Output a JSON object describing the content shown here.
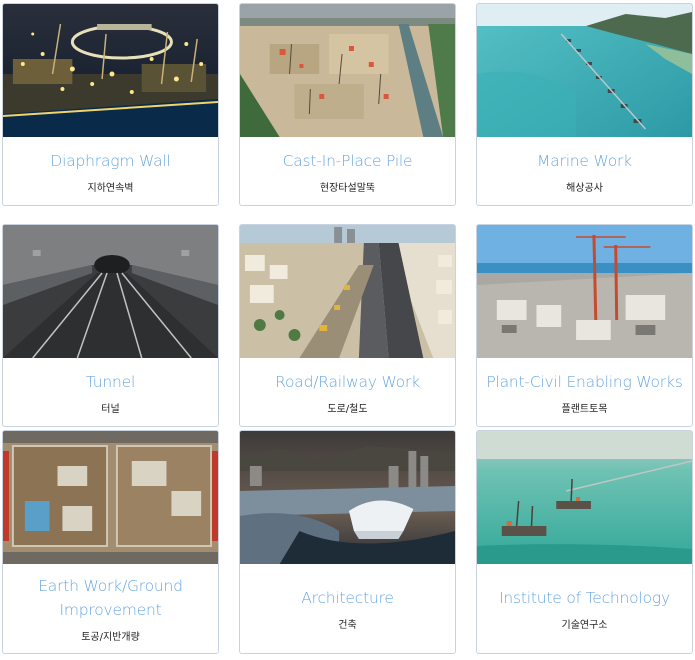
{
  "colors": {
    "title": "#6aa7e0",
    "subtitle": "#222222",
    "border": "#c9d3df"
  },
  "cards": [
    {
      "title": "Diaphragm Wall",
      "subtitle": "지하연속벽",
      "image": "diaphragm-wall-photo"
    },
    {
      "title": "Cast-In-Place Pile",
      "subtitle": "현장타설말뚝",
      "image": "cast-in-place-pile-photo"
    },
    {
      "title": "Marine Work",
      "subtitle": "해상공사",
      "image": "marine-work-photo"
    },
    {
      "title": "Tunnel",
      "subtitle": "터널",
      "image": "tunnel-photo"
    },
    {
      "title": "Road/Railway Work",
      "subtitle": "도로/철도",
      "image": "road-railway-photo"
    },
    {
      "title": "Plant-Civil Enabling Works",
      "subtitle": "플랜트토목",
      "image": "plant-civil-photo"
    },
    {
      "title": "Earth Work/Ground Improvement",
      "subtitle": "토공/지반개량",
      "image": "earth-work-photo"
    },
    {
      "title": "Architecture",
      "subtitle": "건축",
      "image": "architecture-photo"
    },
    {
      "title": "Institute of Technology",
      "subtitle": "기술연구소",
      "image": "institute-of-technology-photo"
    }
  ]
}
